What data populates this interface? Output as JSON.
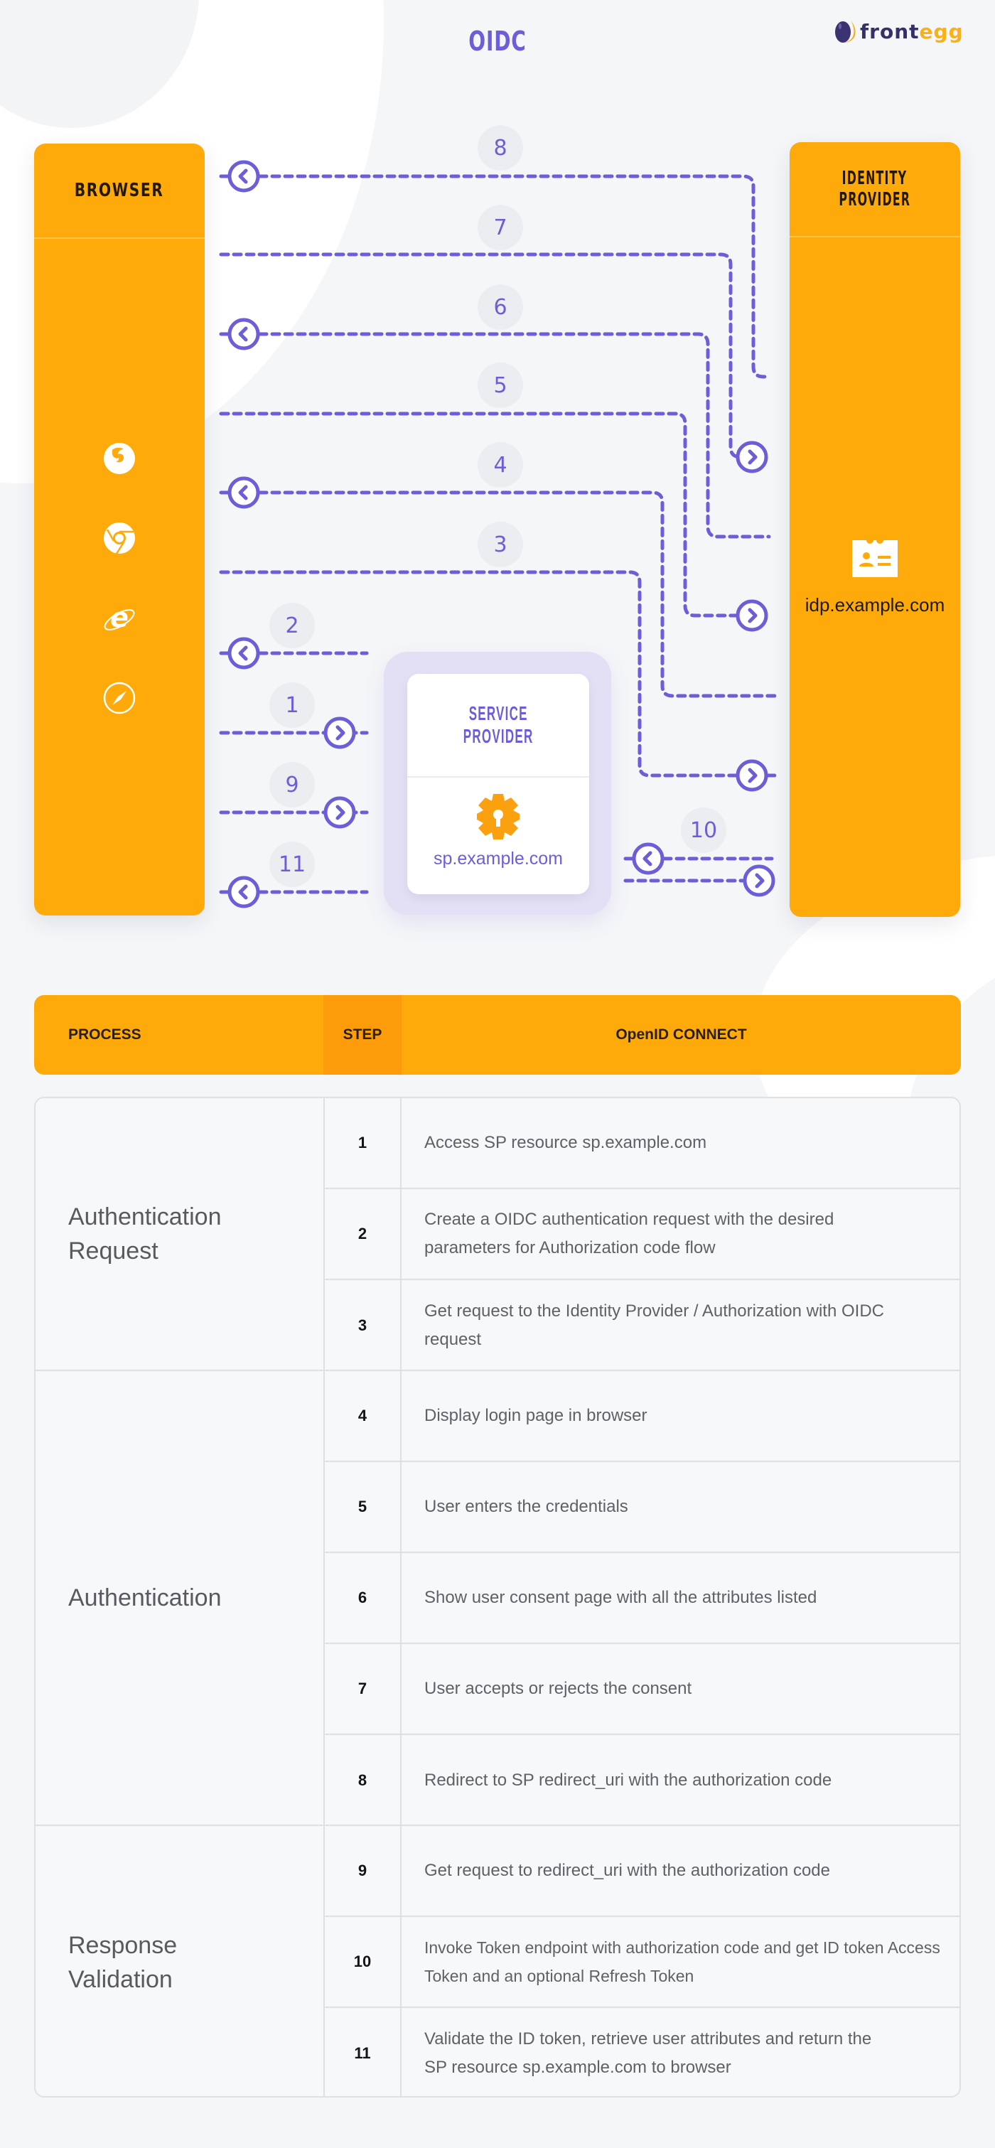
{
  "header": {
    "title": "OIDC",
    "logo": {
      "part1": "front",
      "part2": "egg",
      "icon": "egg-icon"
    }
  },
  "colors": {
    "orange": "#fdaa0a",
    "purple": "#6c5ed6",
    "navy": "#352f6b",
    "yellow": "#fbb116",
    "badge_bg": "#ecedf0"
  },
  "diagram": {
    "browser": {
      "title": "BROWSER",
      "icons": [
        "firefox-icon",
        "chrome-icon",
        "internet-explorer-icon",
        "safari-icon"
      ]
    },
    "identity_provider": {
      "title_line1": "IDENTITY",
      "title_line2": "PROVIDER",
      "icon": "id-card-icon",
      "domain": "idp.example.com"
    },
    "service_provider": {
      "title_line1": "SERVICE",
      "title_line2": "PROVIDER",
      "icon": "gear-keyhole-icon",
      "domain": "sp.example.com"
    },
    "flows": [
      {
        "step": "8",
        "from": "Identity Provider",
        "to": "Browser",
        "direction": "left"
      },
      {
        "step": "7",
        "from": "Browser",
        "to": "Identity Provider",
        "direction": "right"
      },
      {
        "step": "6",
        "from": "Identity Provider",
        "to": "Browser",
        "direction": "left"
      },
      {
        "step": "5",
        "from": "Browser",
        "to": "Identity Provider",
        "direction": "right"
      },
      {
        "step": "4",
        "from": "Identity Provider",
        "to": "Browser",
        "direction": "left"
      },
      {
        "step": "3",
        "from": "Browser",
        "to": "Identity Provider",
        "direction": "right"
      },
      {
        "step": "2",
        "from": "Service Provider",
        "to": "Browser",
        "direction": "left"
      },
      {
        "step": "1",
        "from": "Browser",
        "to": "Service Provider",
        "direction": "right"
      },
      {
        "step": "9",
        "from": "Browser",
        "to": "Service Provider",
        "direction": "right"
      },
      {
        "step": "11",
        "from": "Service Provider",
        "to": "Browser",
        "direction": "left"
      },
      {
        "step": "10",
        "from": "Service Provider",
        "to": "Identity Provider",
        "direction": "both"
      }
    ]
  },
  "table": {
    "headers": {
      "process": "PROCESS",
      "step": "STEP",
      "description": "OpenID CONNECT"
    },
    "groups": [
      {
        "process": "Authentication Request",
        "rows": [
          {
            "step": "1",
            "description": "Access SP resource sp.example.com"
          },
          {
            "step": "2",
            "description": "Create a OIDC authentication request with the desired parameters for Authorization code flow"
          },
          {
            "step": "3",
            "description": "Get request to the Identity Provider / Authorization with OIDC request"
          }
        ]
      },
      {
        "process": "Authentication",
        "rows": [
          {
            "step": "4",
            "description": "Display login page in browser"
          },
          {
            "step": "5",
            "description": "User enters the credentials"
          },
          {
            "step": "6",
            "description": "Show user consent page with all the attributes listed"
          },
          {
            "step": "7",
            "description": "User accepts or rejects the consent"
          },
          {
            "step": "8",
            "description": "Redirect to SP redirect_uri with the authorization code"
          }
        ]
      },
      {
        "process": "Response Validation",
        "rows": [
          {
            "step": "9",
            "description": "Get request to redirect_uri with the authorization code"
          },
          {
            "step": "10",
            "description": "Invoke Token endpoint with authorization code and get ID token Access Token and an optional Refresh Token"
          },
          {
            "step": "11",
            "description": "Validate the ID token, retrieve user attributes and return the SP resource sp.example.com to browser"
          }
        ]
      }
    ]
  }
}
